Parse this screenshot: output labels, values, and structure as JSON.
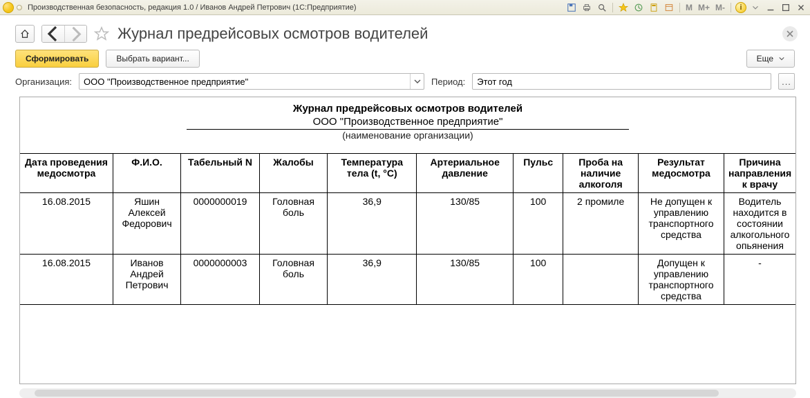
{
  "window": {
    "title": "Производственная безопасность, редакция 1.0 / Иванов Андрей Петрович  (1С:Предприятие)"
  },
  "page": {
    "title": "Журнал предрейсовых осмотров водителей"
  },
  "actions": {
    "generate": "Сформировать",
    "choose_variant": "Выбрать вариант...",
    "more": "Еще"
  },
  "filters": {
    "org_label": "Организация:",
    "org_value": "ООО \"Производственное предприятие\"",
    "period_label": "Период:",
    "period_value": "Этот год"
  },
  "report": {
    "title": "Журнал предрейсовых осмотров водителей",
    "org": "ООО \"Производственное предприятие\"",
    "org_hint": "(наименование организации)",
    "columns": [
      "Дата проведения медосмотра",
      "Ф.И.О.",
      "Табельный N",
      "Жалобы",
      "Температура тела (t, °C)",
      "Артериальное давление",
      "Пульс",
      "Проба на наличие алкоголя",
      "Результат медосмотра",
      "Причина направления к врачу"
    ],
    "rows": [
      {
        "date": "16.08.2015",
        "fio": "Яшин Алексей Федорович",
        "tabn": "0000000019",
        "complaints": "Головная боль",
        "temp": "36,9",
        "bp": "130/85",
        "pulse": "100",
        "alcohol": "2 промиле",
        "result": "Не допущен к управлению транспортного средства",
        "reason": "Водитель находится в состоянии алкогольного опьянения"
      },
      {
        "date": "16.08.2015",
        "fio": "Иванов Андрей Петрович",
        "tabn": "0000000003",
        "complaints": "Головная боль",
        "temp": "36,9",
        "bp": "130/85",
        "pulse": "100",
        "alcohol": "",
        "result": "Допущен к управлению транспортного средства",
        "reason": "-"
      }
    ]
  },
  "titlebar_mem": {
    "m": "M",
    "mplus": "M+",
    "mminus": "M-"
  }
}
